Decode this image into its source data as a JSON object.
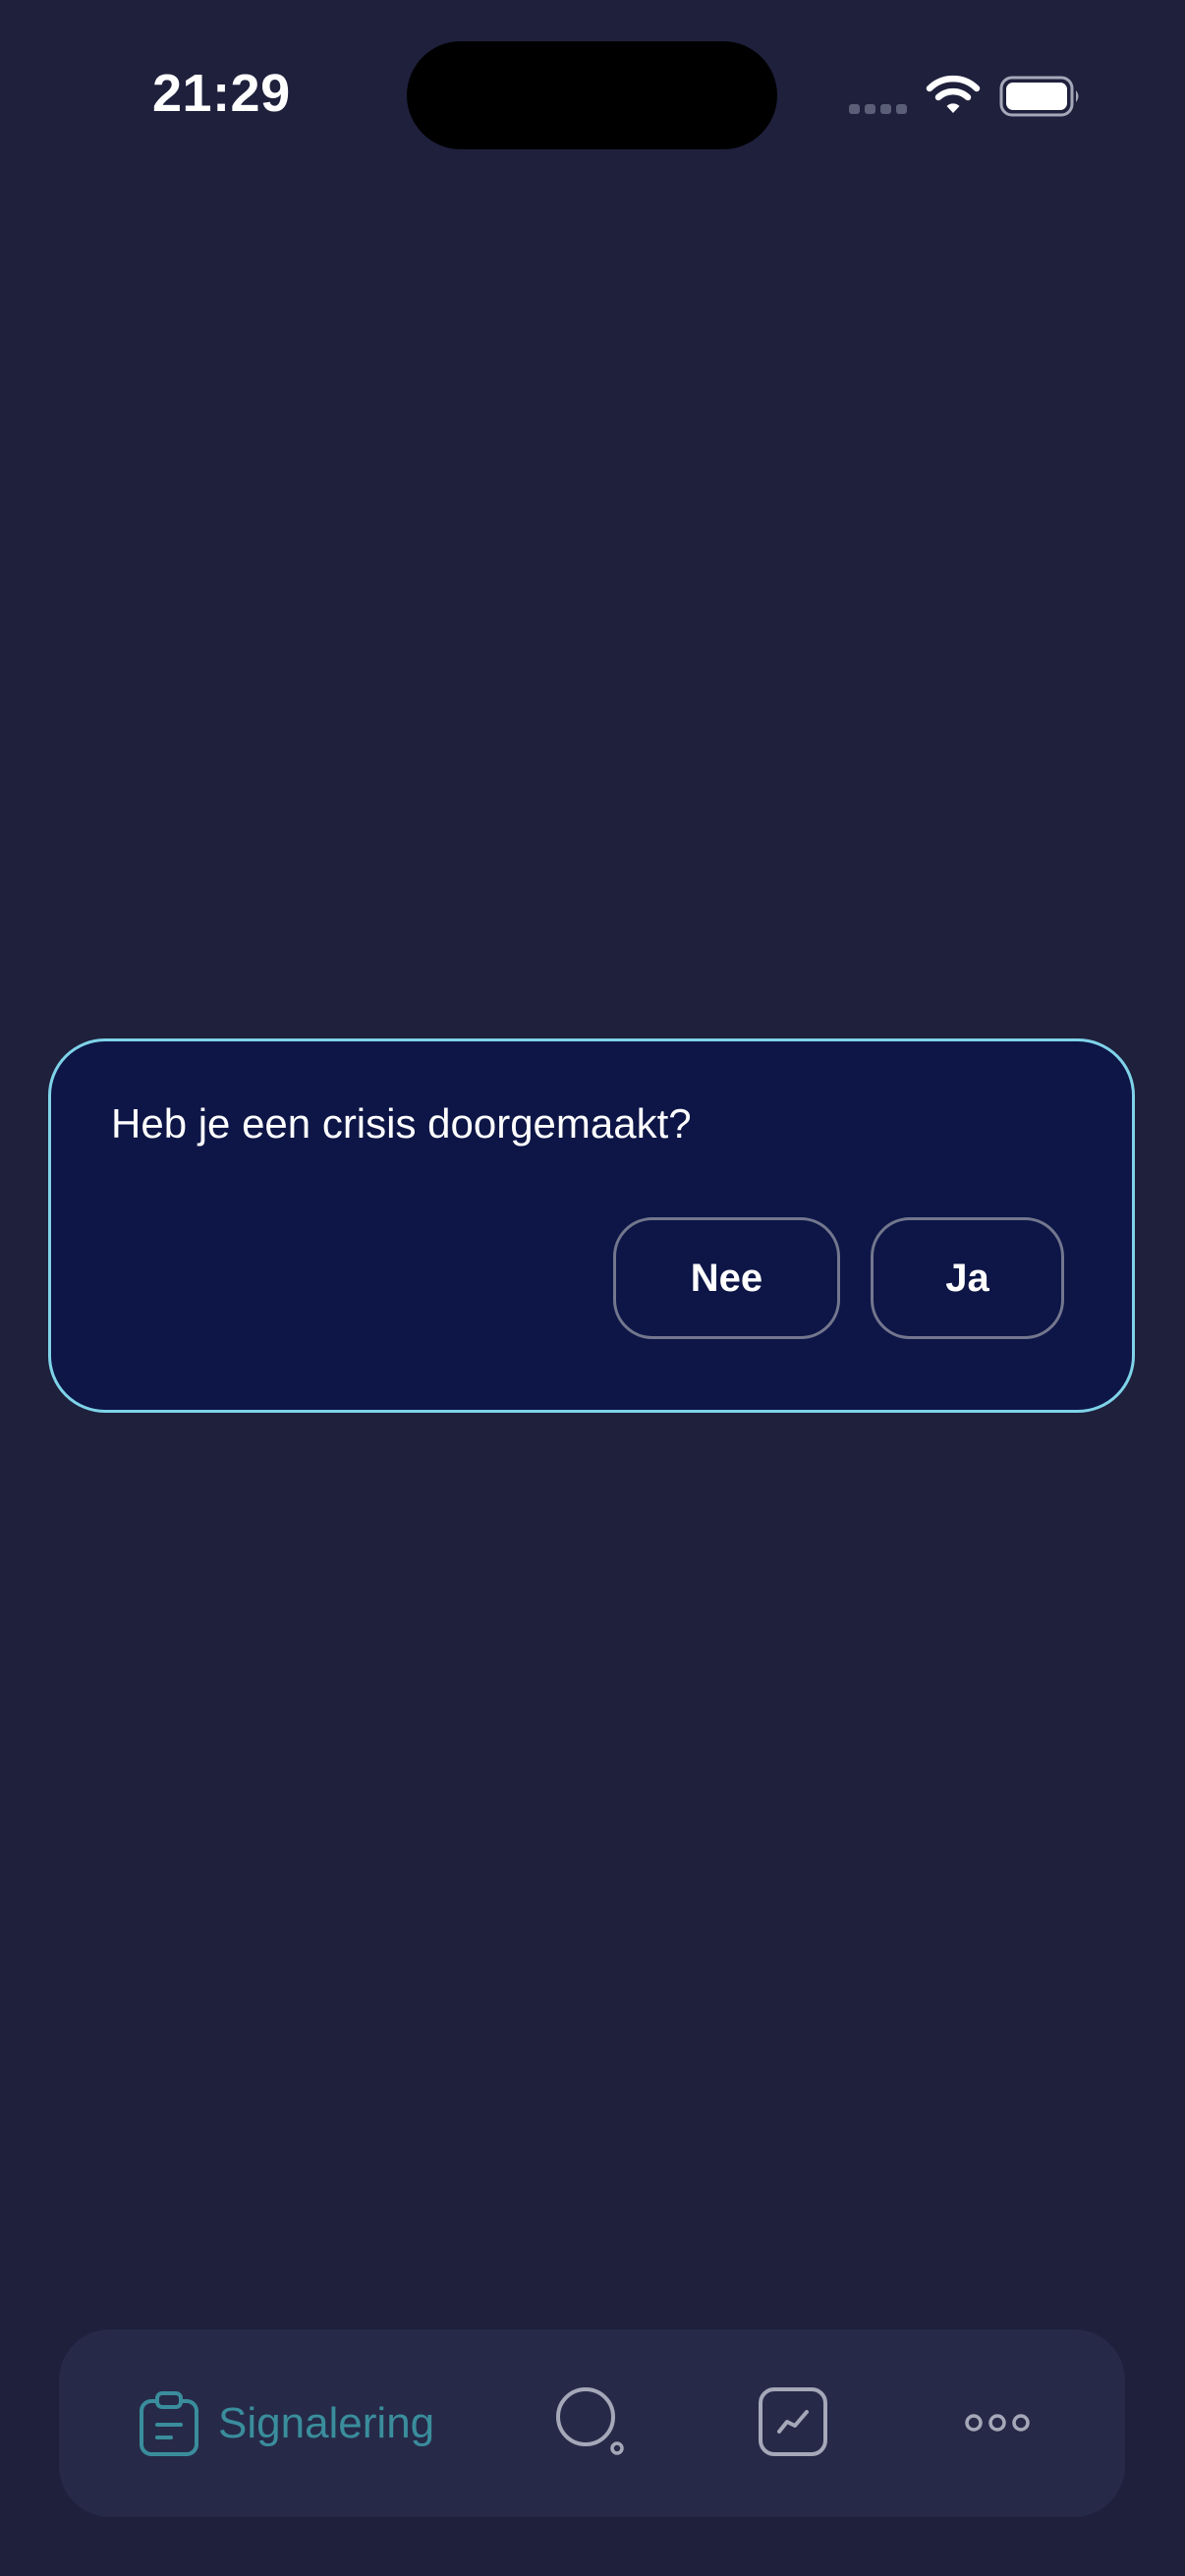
{
  "status_bar": {
    "time": "21:29",
    "signal_icon": "cellular-signal-icon",
    "wifi_icon": "wifi-icon",
    "battery_icon": "battery-full-icon"
  },
  "dialog": {
    "question": "Heb je een crisis doorgemaakt?",
    "no_label": "Nee",
    "yes_label": "Ja"
  },
  "tab_bar": {
    "active_color": "#3a8d9c",
    "tabs": [
      {
        "label": "Signalering",
        "icon": "clipboard-icon",
        "active": true
      },
      {
        "icon": "search-icon",
        "active": false
      },
      {
        "icon": "chart-icon",
        "active": false
      },
      {
        "icon": "more-icon",
        "active": false
      }
    ]
  },
  "colors": {
    "background": "#1e203c",
    "dialog_background": "#0d1646",
    "dialog_border": "#7fd3e9",
    "tab_bar_background": "#262a48"
  }
}
